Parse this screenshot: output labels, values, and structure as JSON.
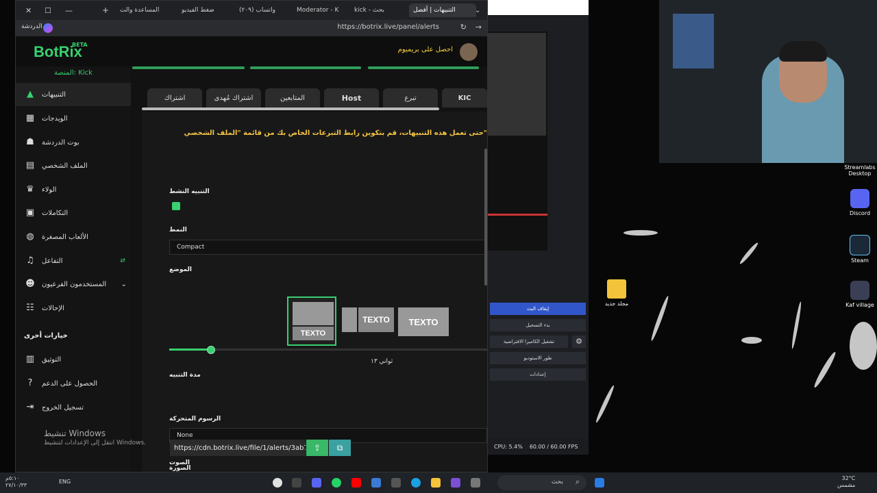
{
  "browser": {
    "tabs": [
      "التنبيهات | أفضل",
      "kick - بحث",
      "Moderator - K",
      "واتساب (٢٠٩)",
      "ضغط الفيديو",
      "المساعدة والت"
    ],
    "url": "https://botrix.live/panel/alerts",
    "chat_label": "الدردشة"
  },
  "header": {
    "logo": "BotRix",
    "beta": "BETA",
    "premium": "احصل على بريميوم"
  },
  "sidebar": {
    "platform": "المنصة: Kick",
    "items": [
      {
        "label": "التنبيهات",
        "icon": "alert-icon"
      },
      {
        "label": "الويدجات",
        "icon": "widgets-icon"
      },
      {
        "label": "بوت الدردشة",
        "icon": "bot-icon"
      },
      {
        "label": "الملف الشخصي",
        "icon": "profile-icon"
      },
      {
        "label": "الولاء",
        "icon": "trophy-icon"
      },
      {
        "label": "التكاملات",
        "icon": "integrations-icon"
      },
      {
        "label": "الألعاب المصغرة",
        "icon": "gamepad-icon"
      },
      {
        "label": "التفاعل",
        "icon": "music-icon"
      },
      {
        "label": "المستخدمون الفرعيون",
        "icon": "users-icon"
      },
      {
        "label": "الإحالات",
        "icon": "referral-icon"
      }
    ],
    "section_title": "خيارات أخرى",
    "other_items": [
      {
        "label": "التوثيق",
        "icon": "docs-icon"
      },
      {
        "label": "الحصول على الدعم",
        "icon": "help-icon"
      },
      {
        "label": "تسجيل الخروج",
        "icon": "logout-icon"
      }
    ]
  },
  "alert_tabs": [
    "KIC",
    "تبرع",
    "Host",
    "المتابعين",
    "اشتراك مُهدى",
    "اشتراك"
  ],
  "form": {
    "warning": "حتى تعمل هذه التنبيهات، قم بتكوين رابط التبرعات الخاص بك من قائمة \"الملف الشخصي\"",
    "active_label": "التنبيه النشط",
    "style_label": "النمط",
    "style_value": "Compact",
    "position_label": "الموضع",
    "position_text": "TEXTO",
    "duration_label": "مدة التنبيه",
    "duration_value": "ثواني ١٣",
    "duration_fraction": 0.13,
    "animation_label": "الرسوم المتحركة",
    "animation_value": "None",
    "image_label": "الصورة",
    "image_url": "https://cdn.botrix.live/file/1/alerts/3ab7",
    "sound_label": "الصوت"
  },
  "obs": {
    "buttons": [
      "إيقاف البث",
      "بدء التسجيل",
      "تشغيل الكاميرا الافتراضية",
      "طور الاستوديو",
      "إعدادات"
    ],
    "cpu": "CPU: 5.4%",
    "fps": "60.00 / 60.00 FPS"
  },
  "desktop": {
    "icons": [
      "Streamlabs Desktop",
      "Discord",
      "Steam",
      "Kaf village"
    ],
    "folder": "مجلد جديد",
    "watermark_title": "تنشيط Windows",
    "watermark_sub": "انتقل إلى الإعدادات لتنشيط Windows."
  },
  "taskbar": {
    "search": "بحث",
    "lang": "ENG",
    "temp": "32°C",
    "weather": "مشمس",
    "time": "٥:١٠م",
    "date": "٢٧/١٠/٣٣"
  }
}
